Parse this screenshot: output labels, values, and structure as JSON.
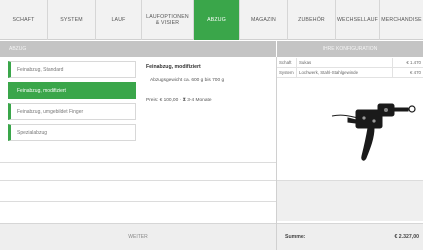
{
  "tabs": [
    {
      "label": "SCHAFT"
    },
    {
      "label": "SYSTEM"
    },
    {
      "label": "LAUF"
    },
    {
      "label": "LAUFOPTIONEN\n& VISIER"
    },
    {
      "label": "ABZUG"
    },
    {
      "label": "MAGAZIN"
    },
    {
      "label": "ZUBEHÖR"
    },
    {
      "label": "WECHSELLAUF"
    },
    {
      "label": "MERCHANDISE"
    }
  ],
  "left_header": "ABZUG",
  "right_header": "IHRE KONFIGURATION",
  "options": [
    {
      "label": "Feinabzug, Standard"
    },
    {
      "label": "Feinabzug, modifiziert"
    },
    {
      "label": "Feinabzug, umgebildet Finger"
    },
    {
      "label": "Spezialabzug"
    }
  ],
  "detail": {
    "title": "Feinabzug, modifiziert",
    "weight": "Abzugsgewicht ca. 600 g bis 700 g",
    "price": "Preis: € 100,00 · ⧗ 3-4 Monate"
  },
  "config_rows": [
    {
      "col1": "Schaft",
      "col2": "Sukas",
      "col3": "€ 1.470"
    },
    {
      "col1": "System",
      "col2": "Lochwerk, Stahl-Stahlgewinde",
      "col3": "€ 470"
    }
  ],
  "weiter_label": "WEITER",
  "summe_label": "Summe:",
  "summe_value": "€ 2.327,00",
  "colors": {
    "accent": "#3aa64a",
    "header": "#c4c4c4"
  }
}
